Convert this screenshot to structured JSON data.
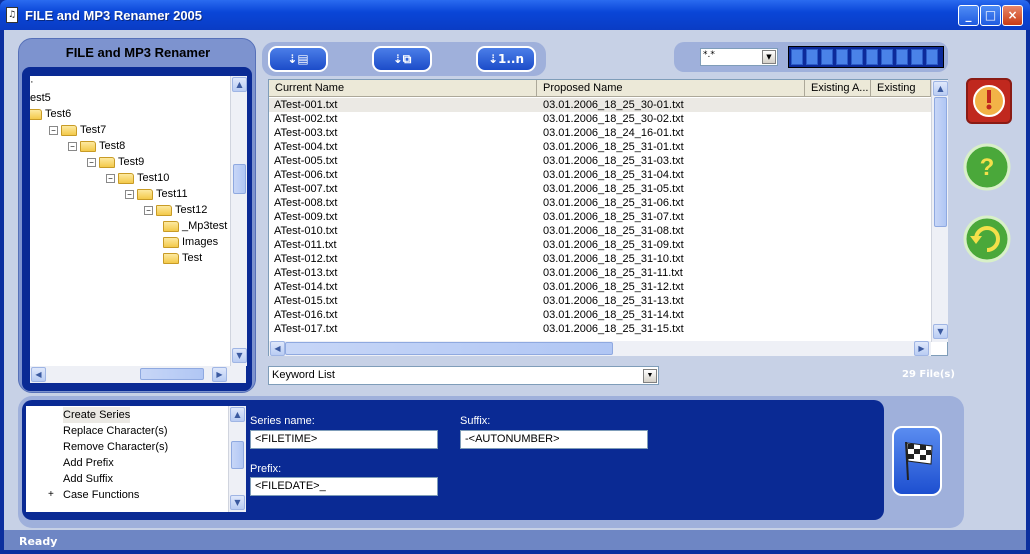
{
  "window": {
    "title": "FILE and MP3 Renamer 2005",
    "minimize": "_",
    "maximize": "□",
    "close": "×"
  },
  "left_panel": {
    "title": "FILE and MP3 Renamer"
  },
  "tree": [
    {
      "label": "·",
      "depth": 0,
      "expand": ""
    },
    {
      "label": "est5",
      "depth": 0,
      "expand": ""
    },
    {
      "label": "Test6",
      "depth": 0,
      "expand": ""
    },
    {
      "label": "Test7",
      "depth": 1,
      "expand": "−"
    },
    {
      "label": "Test8",
      "depth": 2,
      "expand": "−"
    },
    {
      "label": "Test9",
      "depth": 3,
      "expand": "−"
    },
    {
      "label": "Test10",
      "depth": 4,
      "expand": "−"
    },
    {
      "label": "Test11",
      "depth": 5,
      "expand": "−"
    },
    {
      "label": "Test12",
      "depth": 6,
      "expand": "−"
    },
    {
      "label": "_Mp3test",
      "depth": 7,
      "expand": ""
    },
    {
      "label": "Images",
      "depth": 7,
      "expand": ""
    },
    {
      "label": "Test",
      "depth": 7,
      "expand": ""
    }
  ],
  "filter": {
    "value": "*.*"
  },
  "progress": {
    "segments": 10
  },
  "list": {
    "columns": [
      "Current Name",
      "Proposed Name",
      "Existing A...",
      "Existing T..."
    ],
    "rows": [
      [
        "ATest-001.txt",
        "03.01.2006_18_25_30-01.txt"
      ],
      [
        "ATest-002.txt",
        "03.01.2006_18_25_30-02.txt"
      ],
      [
        "ATest-003.txt",
        "03.01.2006_18_24_16-01.txt"
      ],
      [
        "ATest-004.txt",
        "03.01.2006_18_25_31-01.txt"
      ],
      [
        "ATest-005.txt",
        "03.01.2006_18_25_31-03.txt"
      ],
      [
        "ATest-006.txt",
        "03.01.2006_18_25_31-04.txt"
      ],
      [
        "ATest-007.txt",
        "03.01.2006_18_25_31-05.txt"
      ],
      [
        "ATest-008.txt",
        "03.01.2006_18_25_31-06.txt"
      ],
      [
        "ATest-009.txt",
        "03.01.2006_18_25_31-07.txt"
      ],
      [
        "ATest-010.txt",
        "03.01.2006_18_25_31-08.txt"
      ],
      [
        "ATest-011.txt",
        "03.01.2006_18_25_31-09.txt"
      ],
      [
        "ATest-012.txt",
        "03.01.2006_18_25_31-10.txt"
      ],
      [
        "ATest-013.txt",
        "03.01.2006_18_25_31-11.txt"
      ],
      [
        "ATest-014.txt",
        "03.01.2006_18_25_31-12.txt"
      ],
      [
        "ATest-015.txt",
        "03.01.2006_18_25_31-13.txt"
      ],
      [
        "ATest-016.txt",
        "03.01.2006_18_25_31-14.txt"
      ],
      [
        "ATest-017.txt",
        "03.01.2006_18_25_31-15.txt"
      ]
    ]
  },
  "keyword": {
    "value": "Keyword List"
  },
  "file_count": "29 File(s)",
  "functions": [
    "Create Series",
    "Replace Character(s)",
    "Remove Character(s)",
    "Add Prefix",
    "Add Suffix",
    "Case Functions"
  ],
  "series": {
    "series_label": "Series name:",
    "series_value": "<FILETIME>",
    "suffix_label": "Suffix:",
    "suffix_value": "-<AUTONUMBER>",
    "prefix_label": "Prefix:",
    "prefix_value": "<FILEDATE>_"
  },
  "status": "Ready",
  "colors": {
    "accent": "#0a2a94",
    "titlebar": "#0a46d8",
    "panel": "#9fb0db"
  }
}
